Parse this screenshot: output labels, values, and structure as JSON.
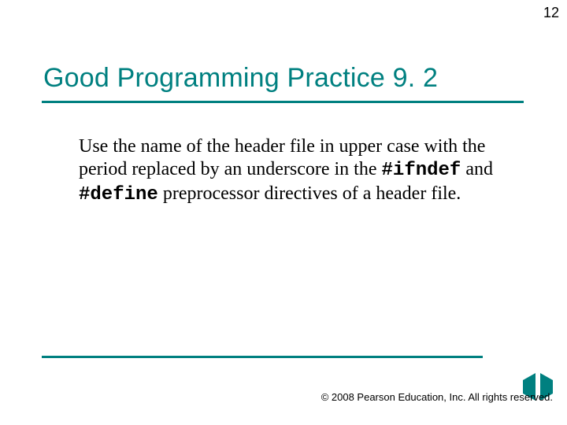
{
  "page_number": "12",
  "title": "Good Programming Practice 9. 2",
  "body": {
    "seg1": "Use the name of the header file in upper case with the period replaced by an underscore in the ",
    "code1": "#ifndef",
    "seg2": " and ",
    "code2": "#define",
    "seg3": " preprocessor directives of a header file."
  },
  "footer": {
    "copyright_symbol": "©",
    "text": " 2008 Pearson Education, Inc.   All rights reserved."
  },
  "nav": {
    "prev_name": "prev-slide-button",
    "next_name": "next-slide-button"
  },
  "colors": {
    "accent": "#008080"
  }
}
